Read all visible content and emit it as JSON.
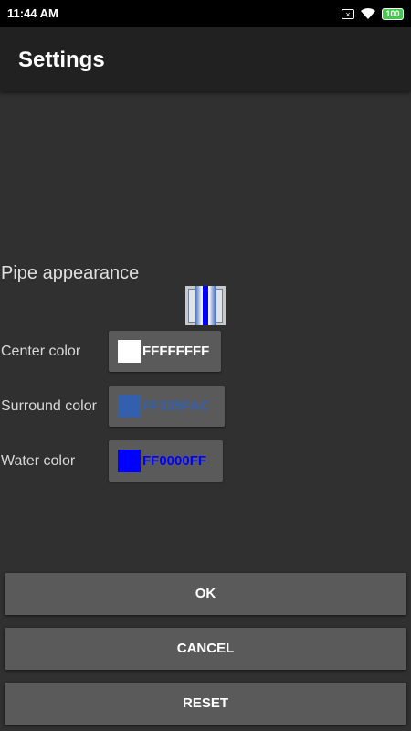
{
  "status_bar": {
    "time": "11:44 AM",
    "sim_icon": "sim-x-icon",
    "wifi_icon": "wifi-icon",
    "battery": "100"
  },
  "app_bar": {
    "title": "Settings"
  },
  "pipe_section": {
    "title": "Pipe appearance",
    "preview_icon": "pipe-preview-icon"
  },
  "colors": {
    "center": {
      "label": "Center color",
      "value": "FFFFFFFF",
      "swatch": "#FFFFFF"
    },
    "surround": {
      "label": "Surround color",
      "value": "FF335FAC",
      "swatch": "#335FAC"
    },
    "water": {
      "label": "Water color",
      "value": "FF0000FF",
      "swatch": "#0000FF"
    }
  },
  "buttons": {
    "ok": "OK",
    "cancel": "CANCEL",
    "reset": "RESET"
  }
}
